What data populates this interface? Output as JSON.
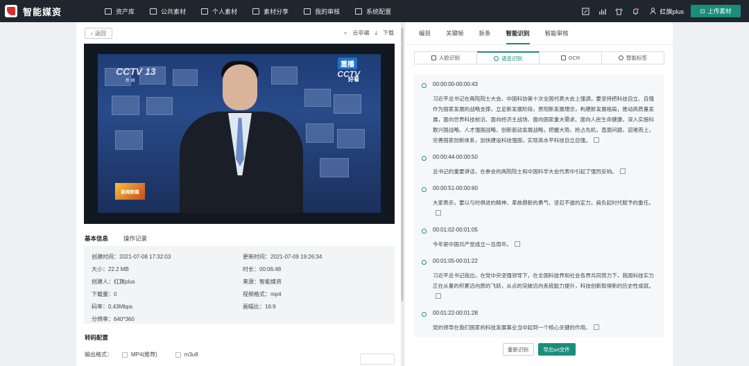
{
  "app": {
    "title": "智能媒资",
    "user": "红旗plus",
    "upload_label": "上传素材"
  },
  "nav": [
    {
      "label": "资产库",
      "icon": "asset-library-icon"
    },
    {
      "label": "公共素材",
      "icon": "public-material-icon"
    },
    {
      "label": "个人素材",
      "icon": "personal-material-icon"
    },
    {
      "label": "素材分享",
      "icon": "share-icon"
    },
    {
      "label": "我的审核",
      "icon": "review-icon"
    },
    {
      "label": "系统配置",
      "icon": "settings-icon"
    }
  ],
  "toolbar": {
    "back": "返回",
    "cloud_edit": "云非编",
    "download": "下载"
  },
  "video": {
    "logo_left": "CCTV 13",
    "logo_left_sub": "新 闻",
    "rebroadcast": "重播",
    "logo_right": "CCTV",
    "logo_right_sub": "好看",
    "program_logo": "新闻联播"
  },
  "info_tabs": [
    "基本信息",
    "操作记录"
  ],
  "info": [
    {
      "label": "创建时间：",
      "value": "2021-07-08 17:32:03"
    },
    {
      "label": "更新时间：",
      "value": "2021-07-09 19:26:34"
    },
    {
      "label": "大小：",
      "value": "22.2 MB"
    },
    {
      "label": "时长：",
      "value": "00:06:48"
    },
    {
      "label": "创建人：",
      "value": "红旗plus"
    },
    {
      "label": "来源：",
      "value": "智能媒资"
    },
    {
      "label": "下载量：",
      "value": "0"
    },
    {
      "label": "视频格式：",
      "value": "mp4"
    },
    {
      "label": "码率：",
      "value": "0.43Mbps"
    },
    {
      "label": "画幅比：",
      "value": "16:9"
    },
    {
      "label": "分辨率：",
      "value": "640*360"
    }
  ],
  "transcode": {
    "title": "转码配置",
    "format_label": "输出格式：",
    "options": [
      "MP4(推荐)",
      "m3u8"
    ]
  },
  "right_tabs": [
    "编目",
    "关键帧",
    "拆条",
    "智能识别",
    "智能审核"
  ],
  "sub_tabs": [
    "人脸识别",
    "语音识别",
    "OCR",
    "智能标签"
  ],
  "segments": [
    {
      "time": "00:00:00-00:00:43",
      "text": "习近平总书记在两院院士大会、中国科协第十次全国代表大会上强调，要坚持把科技自立、自强作为国家发展的战略支撑，立足新发展阶段，贯彻新发展理念，构建新发展格局，推动高质量发展，面向世界科技前沿、面向经济主战场、面向国家重大需求、面向人民生命健康，深入实施科教兴国战略、人才强国战略、创新驱动发展战略，把握大势、抢占先机，直面问题，迎难而上，完善国家创新体系，加快建设科技强国，实现高水平科技自立自强。"
    },
    {
      "time": "00:00:44-00:00:50",
      "text": "总书记的重要讲话，在参会的两院院士和中国科学大会代表中引起了强烈反响。"
    },
    {
      "time": "00:00:51-00:00:60",
      "text": "大家表示，要以与时俱进的精神、革故鼎新的勇气、坚忍不拔的定力，肩负起时代赋予的重任。"
    },
    {
      "time": "00:01:02-00:01:05",
      "text": "今年是中国共产党成立一百周年。"
    },
    {
      "time": "00:01:05-00:01:22",
      "text": "习近平总书记指出，在党中央坚强领导下，在全国科技界和社会各界共同努力下，我国科技实力正在从量的积累迈向质的飞跃，从点的突破迈向系统能力提升，科技创新取得新的历史性成就。"
    },
    {
      "time": "00:01:22-00:01:28",
      "text": "党的领导在我们国家的科技发展事业当中起到一个核心关键的作用。"
    }
  ],
  "actions": {
    "reidentify": "重新识别",
    "export": "导出srt文件"
  },
  "colors": {
    "accent": "#1a8e7a",
    "topbar": "#1f262e"
  }
}
